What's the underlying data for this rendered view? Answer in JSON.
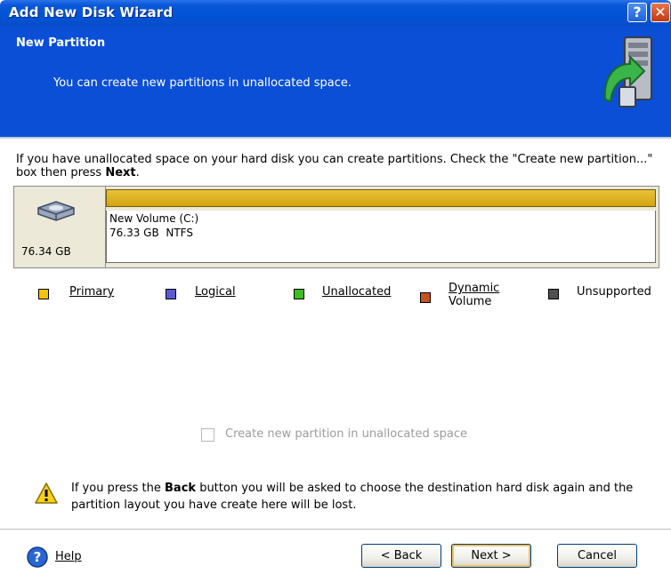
{
  "window": {
    "title": "Add New Disk Wizard"
  },
  "header": {
    "title": "New Partition",
    "subtitle": "You can create new partitions in unallocated space."
  },
  "intro": {
    "text_before": "If you have unallocated space on your hard disk you can create partitions. Check the \"Create new partition...\" box then press ",
    "bold": "Next",
    "text_after": "."
  },
  "disk": {
    "size": "76.34 GB",
    "partition": {
      "name": "New Volume (C:)",
      "size": "76.33 GB",
      "fs": "NTFS"
    }
  },
  "legend": [
    {
      "label": "Primary",
      "color": "#f5c400"
    },
    {
      "label": "Logical",
      "color": "#5a5ad0"
    },
    {
      "label": "Unallocated",
      "color": "#3cbe1c"
    },
    {
      "label": "Dynamic Volume",
      "label_line1": "Dynamic",
      "label_line2": "Volume",
      "color": "#c8501e"
    },
    {
      "label": "Unsupported",
      "color": "#505050"
    }
  ],
  "checkbox": {
    "label": "Create new partition in unallocated space",
    "checked": false,
    "enabled": false
  },
  "warning": {
    "text_before": "If you press the ",
    "bold": "Back",
    "text_after": " button you will be asked to choose the destination hard disk again and the partition layout you have create here will be lost."
  },
  "footer": {
    "help_label": "Help",
    "back_label": "< Back",
    "next_label": "Next >",
    "cancel_label": "Cancel"
  },
  "colors": {
    "titlebar": "#0052d6",
    "header": "#0a4fd6",
    "partition_bar": "#e0b520"
  }
}
